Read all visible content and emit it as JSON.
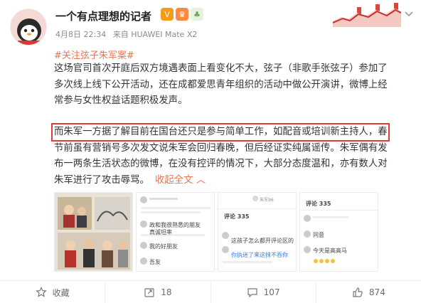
{
  "post": {
    "author": "一个有点理想的记者",
    "date": "4月8日 22:34",
    "source": "来自 HUAWEI Mate X2",
    "topic": "#关注弦子朱军案#",
    "paragraph1": [
      "这场官司首次开庭后双方境遇表面上看变化不大，弦子（非歌手张弦子）参加了",
      "多次线上线下公开活动，还在成都爱思青年组织的活动中做公开演讲，微博上经",
      "常参与女性权益话题积极发声。"
    ],
    "paragraph2": [
      "而朱军一方据了解目前在国台还只是参与简单工作，如配音或培训新主持人，春",
      "节前虽有营销号多次发文说朱军会回归春晚，但后经证实纯属谣传。朱军偶有发",
      "布一两条生活状态的微博，在没有控评的情况下，大部分态度温和，亦有数人对",
      "朱军进行了攻击辱骂。"
    ],
    "expand_label": "收起全文 ︿"
  },
  "thumbnails": {
    "t2": {
      "line1": "政和我很熟悉的朋友",
      "line2": "真诚坦率",
      "line3": "我的好朋友",
      "line4": "吾友"
    },
    "t3": {
      "name": "朱军96",
      "title": "评论 335",
      "line1": "这孩子怎么都开评论区的",
      "line2": "你执迷了来这抹不吞你"
    },
    "t4": {
      "title": "评论 335",
      "line1": "同意",
      "line2": "今天是高高马"
    }
  },
  "actions": {
    "favorite": "收藏",
    "repost": "18",
    "comment": "107",
    "like": "874"
  },
  "colors": {
    "topic": "#eb7350",
    "highlight": "#e03a3a",
    "verified": "#f59b1a"
  }
}
